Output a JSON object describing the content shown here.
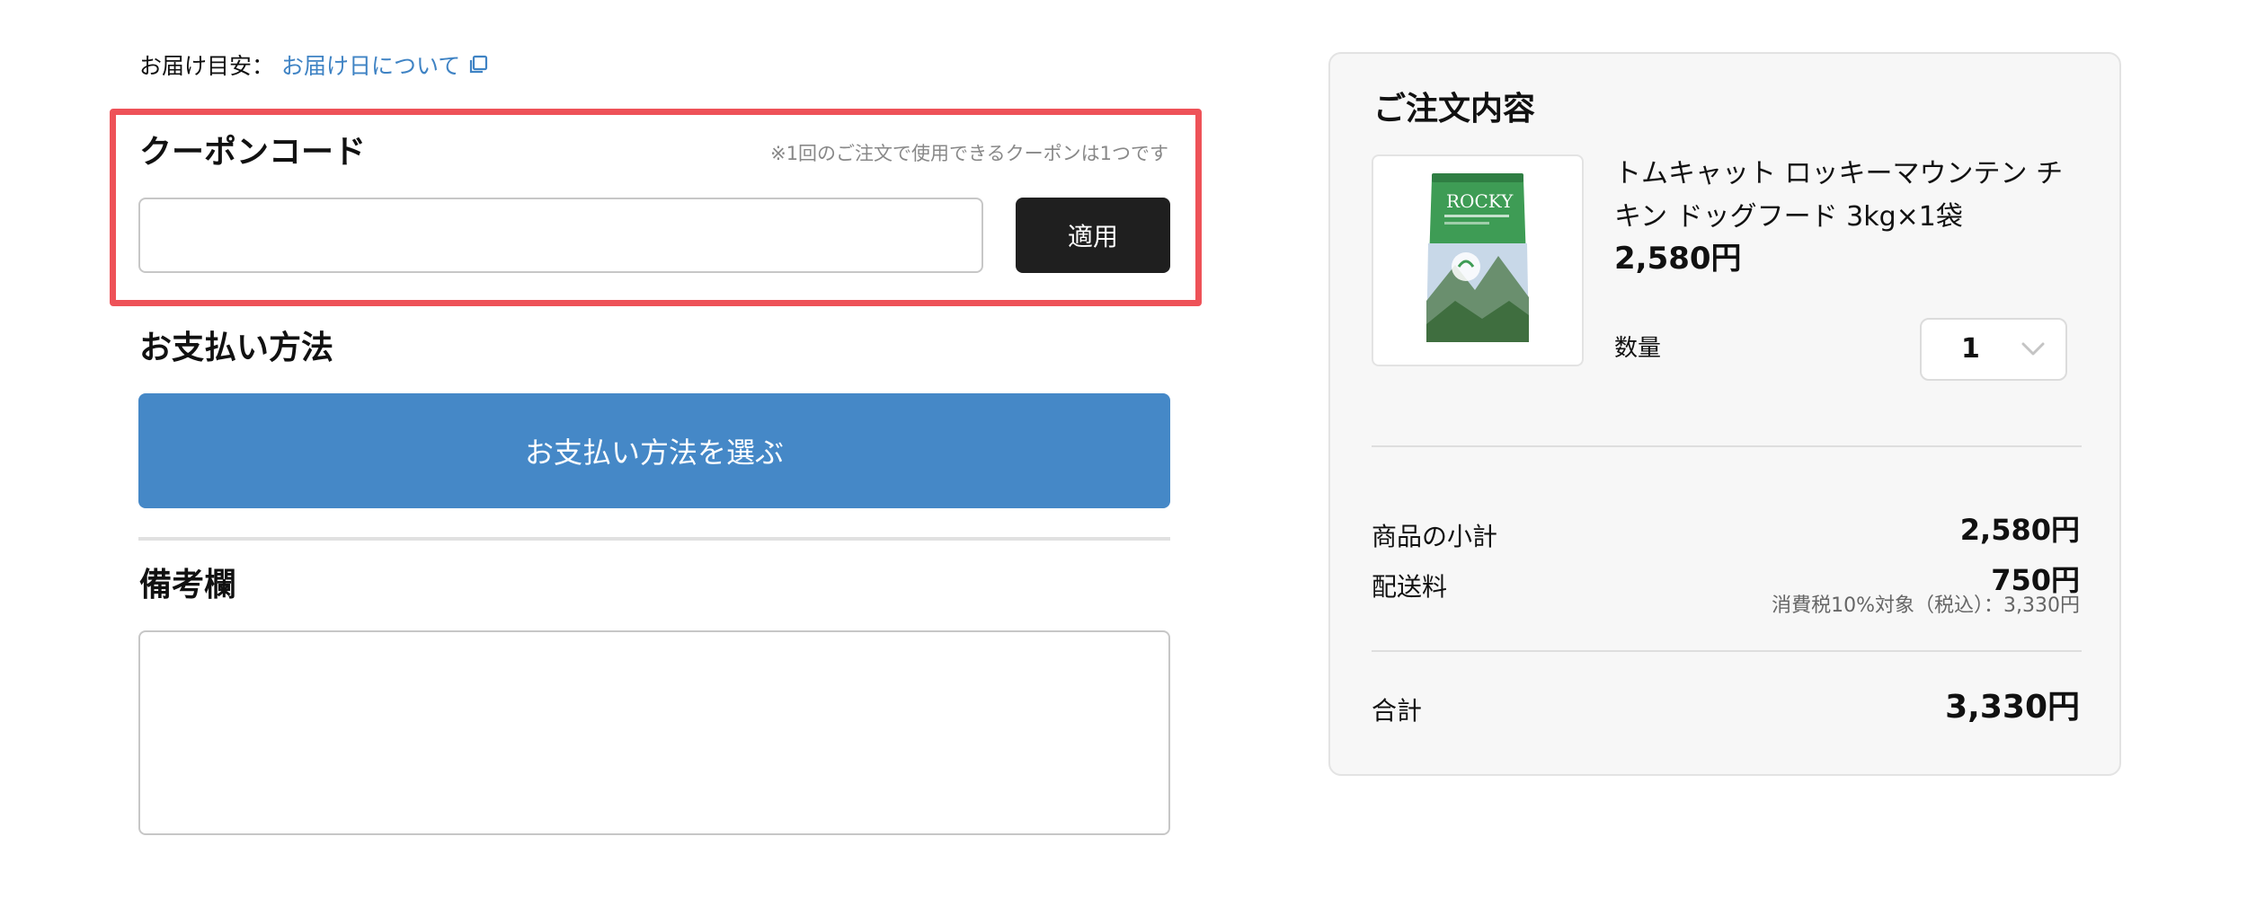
{
  "delivery": {
    "label": "お届け目安：",
    "link_text": "お届け日について",
    "link_icon": "external-window-icon",
    "link_color": "#3f83c4"
  },
  "coupon": {
    "title": "クーポンコード",
    "note": "※1回のご注文で使用できるクーポンは1つです",
    "input_value": "",
    "input_placeholder": "",
    "apply_label": "適用",
    "highlight_color": "#ee5258"
  },
  "payment": {
    "title": "お支払い方法",
    "select_label": "お支払い方法を選ぶ",
    "button_color": "#4588c7"
  },
  "notes": {
    "title": "備考欄",
    "value": "",
    "placeholder": ""
  },
  "order": {
    "title": "ご注文内容",
    "product": {
      "name": "トムキャット ロッキーマウンテン チキン ドッグフード 3kg×1袋",
      "price": "2,580円",
      "image_icon": "dog-food-bag-image",
      "image_brand_text": "ROCKY"
    },
    "quantity": {
      "label": "数量",
      "value": "1",
      "icon": "chevron-down-icon"
    },
    "subtotal": {
      "label": "商品の小計",
      "value": "2,580円"
    },
    "shipping": {
      "label": "配送料",
      "value": "750円"
    },
    "tax_note": "消費税10%対象（税込）：3,330円",
    "total": {
      "label": "合計",
      "value": "3,330円"
    }
  }
}
